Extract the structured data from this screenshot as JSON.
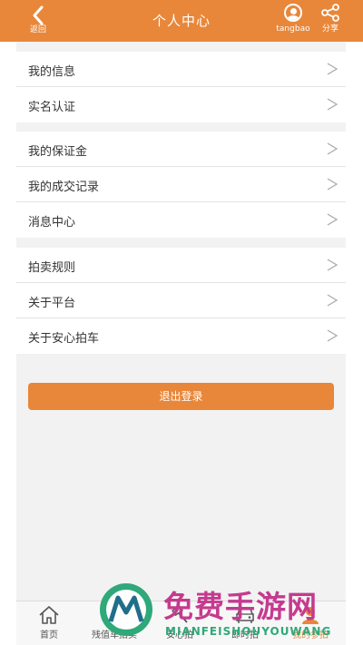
{
  "header": {
    "back_label": "返回",
    "title": "个人中心",
    "username": "tangbao",
    "share_label": "分享"
  },
  "menu": {
    "group1": [
      {
        "label": "我的信息"
      },
      {
        "label": "实名认证"
      }
    ],
    "group2": [
      {
        "label": "我的保证金"
      },
      {
        "label": "我的成交记录"
      },
      {
        "label": "消息中心"
      }
    ],
    "group3": [
      {
        "label": "拍卖规则"
      },
      {
        "label": "关于平台"
      },
      {
        "label": "关于安心拍车"
      }
    ]
  },
  "logout_label": "退出登录",
  "tabbar": {
    "tabs": [
      {
        "label": "首页",
        "icon": "home-icon"
      },
      {
        "label": "残值车拍卖",
        "icon": "car-icon"
      },
      {
        "label": "安心拍",
        "icon": "hammer-icon"
      },
      {
        "label": "即时拍",
        "icon": "car-front-icon"
      },
      {
        "label": "我的参拍",
        "icon": "user-icon",
        "active": true
      }
    ]
  },
  "watermark": {
    "title": "免费手游网",
    "subtitle": "MIANFEISHOUYOUWANG"
  },
  "colors": {
    "accent": "#e8873a",
    "background": "#f2f2f2",
    "watermark_pink": "#c53a8f",
    "watermark_green": "#2fa87a"
  }
}
